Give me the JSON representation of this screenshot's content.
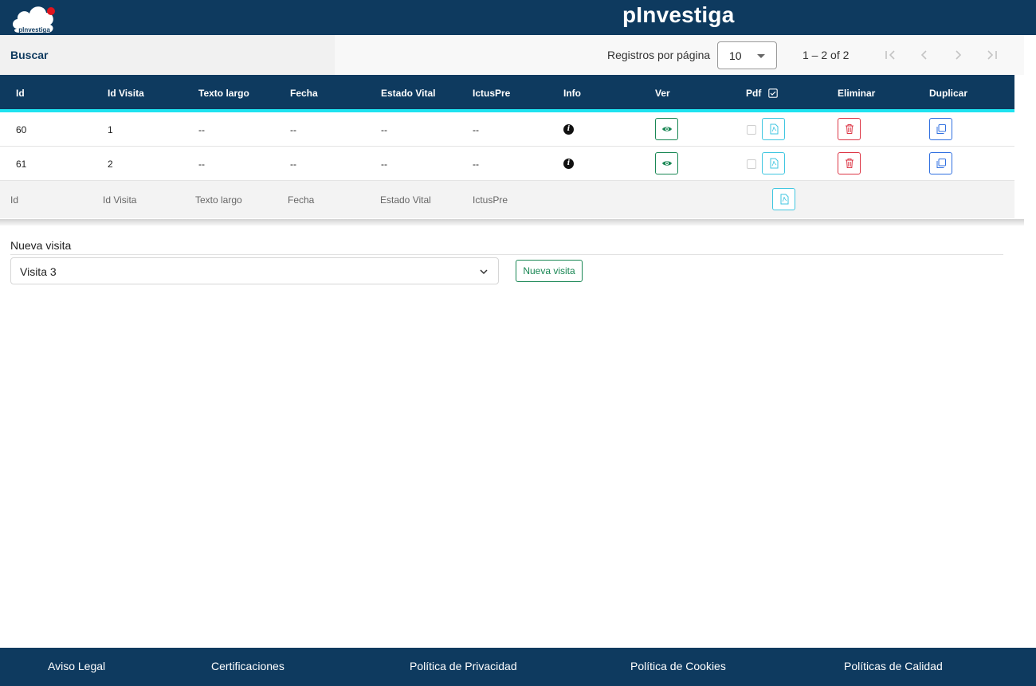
{
  "header": {
    "logo_text": "pInvestiga",
    "title": "pInvestiga"
  },
  "toolbar": {
    "search_label": "Buscar",
    "rows_per_page_label": "Registros por página",
    "rows_per_page_value": "10",
    "range_label": "1 – 2 of 2",
    "pager_icons": [
      "first-page-icon",
      "previous-page-icon",
      "next-page-icon",
      "last-page-icon"
    ]
  },
  "table": {
    "columns": [
      "Id",
      "Id Visita",
      "Texto largo",
      "Fecha",
      "Estado Vital",
      "IctusPre",
      "Info",
      "Ver",
      "Pdf",
      "Eliminar",
      "Duplicar"
    ],
    "rows": [
      {
        "id": "60",
        "id_visita": "1",
        "texto_largo": "--",
        "fecha": "--",
        "estado_vital": "--",
        "ictus_pre": "--",
        "pdf_checked": false
      },
      {
        "id": "61",
        "id_visita": "2",
        "texto_largo": "--",
        "fecha": "--",
        "estado_vital": "--",
        "ictus_pre": "--",
        "pdf_checked": false
      }
    ],
    "footer_columns": [
      "Id",
      "Id Visita",
      "Texto largo",
      "Fecha",
      "Estado Vital",
      "IctusPre"
    ],
    "icons": {
      "info": "info-icon",
      "ver": "eye-icon",
      "pdf": "pdf-file-icon",
      "eliminar": "trash-icon",
      "duplicar": "copy-icon"
    }
  },
  "nueva_visita": {
    "label": "Nueva visita",
    "select_value": "Visita 3",
    "button_label": "Nueva visita"
  },
  "footer": {
    "links": [
      "Aviso Legal",
      "Certificaciones",
      "Política de Privacidad",
      "Política de Cookies",
      "Políticas de Calidad"
    ]
  },
  "colors": {
    "header": "#0e3a5f",
    "accent": "#1ee3f0",
    "view_green": "#198754",
    "pdf_cyan": "#3fc6e0",
    "delete_red": "#dc3545",
    "duplicate_blue": "#2f6fe0"
  }
}
